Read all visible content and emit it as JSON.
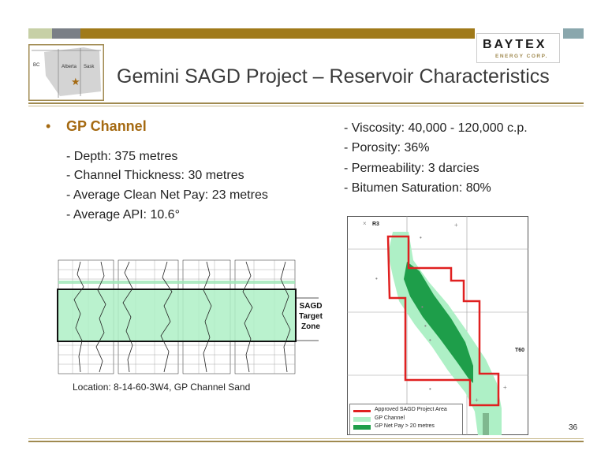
{
  "colors": {
    "accent": "#a56a12",
    "rule": "#a08a50",
    "channel_green": "#aef0c6",
    "netpay_green": "#1e9e4a",
    "project_red": "#e02020"
  },
  "header": {
    "title": "Gemini SAGD Project – Reservoir Characteristics",
    "logo": {
      "word": "BAYTEX",
      "sub": "ENERGY CORP."
    },
    "map_labels": {
      "bc": "BC",
      "alberta": "Alberta",
      "sask": "Sask"
    }
  },
  "section": {
    "bullet": "•",
    "heading": "GP Channel",
    "left_items": [
      "- Depth: 375 metres",
      "- Channel Thickness: 30 metres",
      "- Average Clean Net Pay: 23 metres",
      "- Average API: 10.6°"
    ],
    "right_items": [
      "- Viscosity: 40,000 - 120,000 c.p.",
      "- Porosity: 36%",
      "- Permeability: 3 darcies",
      "- Bitumen Saturation: 80%"
    ]
  },
  "well_log": {
    "label_lines": [
      "SAGD",
      "Target",
      "Zone"
    ],
    "caption": "Location: 8-14-60-3W4, GP Channel Sand"
  },
  "map": {
    "range_label": "R3",
    "township_label": "T60",
    "legend": [
      {
        "label": "Approved SAGD Project Area",
        "color": "#e02020"
      },
      {
        "label": "GP Channel",
        "color": "#aef0c6"
      },
      {
        "label": "GP Net Pay > 20 metres",
        "color": "#1e9e4a"
      }
    ]
  },
  "page_number": "36"
}
